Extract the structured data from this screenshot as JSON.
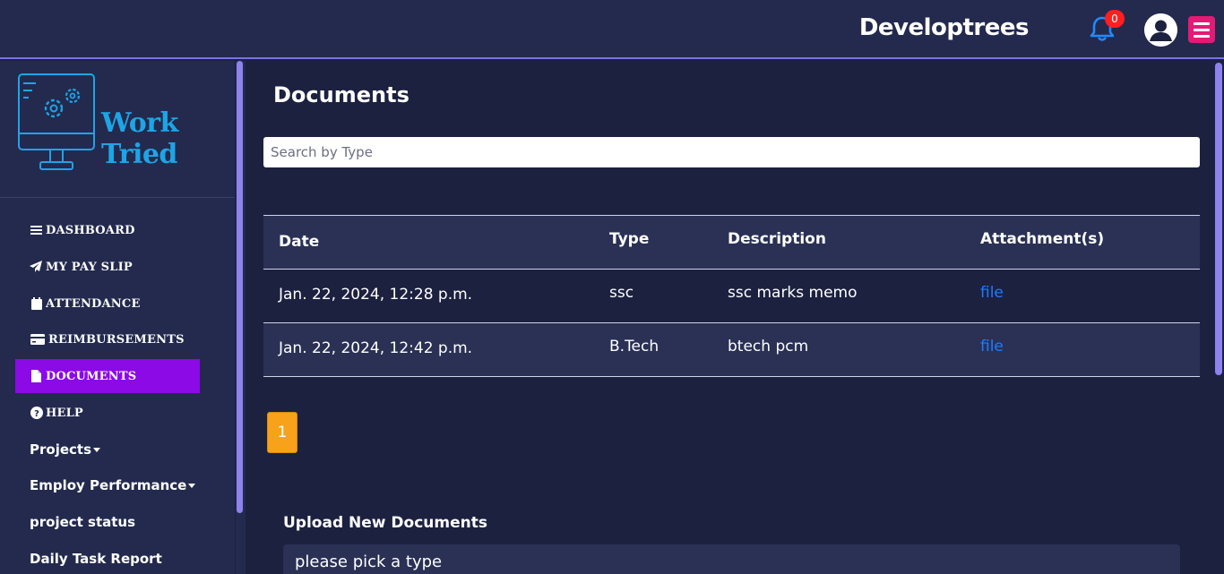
{
  "header": {
    "brand": "Developtrees",
    "notification_count": "0"
  },
  "sidebar": {
    "logo_text": "Work Tried",
    "items": [
      {
        "label": "DASHBOARD",
        "icon": "bars-icon"
      },
      {
        "label": "MY PAY SLIP",
        "icon": "paper-plane-icon"
      },
      {
        "label": "ATTENDANCE",
        "icon": "calendar-icon"
      },
      {
        "label": "REIMBURSEMENTS",
        "icon": "credit-card-icon"
      },
      {
        "label": "DOCUMENTS",
        "icon": "file-icon",
        "active": true
      },
      {
        "label": "HELP",
        "icon": "question-circle-icon"
      },
      {
        "label": "Projects",
        "dropdown": true
      },
      {
        "label": "Employ Performance",
        "dropdown": true
      },
      {
        "label": "project status"
      },
      {
        "label": "Daily Task Report"
      }
    ],
    "active_color": "#8b0ae6"
  },
  "main": {
    "title": "Documents",
    "search_placeholder": "Search by Type",
    "table": {
      "headers": [
        "Date",
        "Type",
        "Description",
        "Attachment(s)"
      ],
      "rows": [
        {
          "date": "Jan. 22, 2024, 12:28 p.m.",
          "type": "ssc",
          "description": "ssc marks memo",
          "attachment": "file"
        },
        {
          "date": "Jan. 22, 2024, 12:42 p.m.",
          "type": "B.Tech",
          "description": "btech pcm",
          "attachment": "file"
        }
      ]
    },
    "pagination": {
      "current_page": "1"
    },
    "upload": {
      "title": "Upload New Documents",
      "type_select_value": "please pick a type"
    }
  },
  "colors": {
    "background": "#1c2140",
    "panel": "#232a4e",
    "accent_scroll": "#8d82ee",
    "link": "#1e7bff",
    "page_button": "#f7a21a",
    "menu_button": "#e51a75",
    "badge": "#ff1f1f"
  }
}
